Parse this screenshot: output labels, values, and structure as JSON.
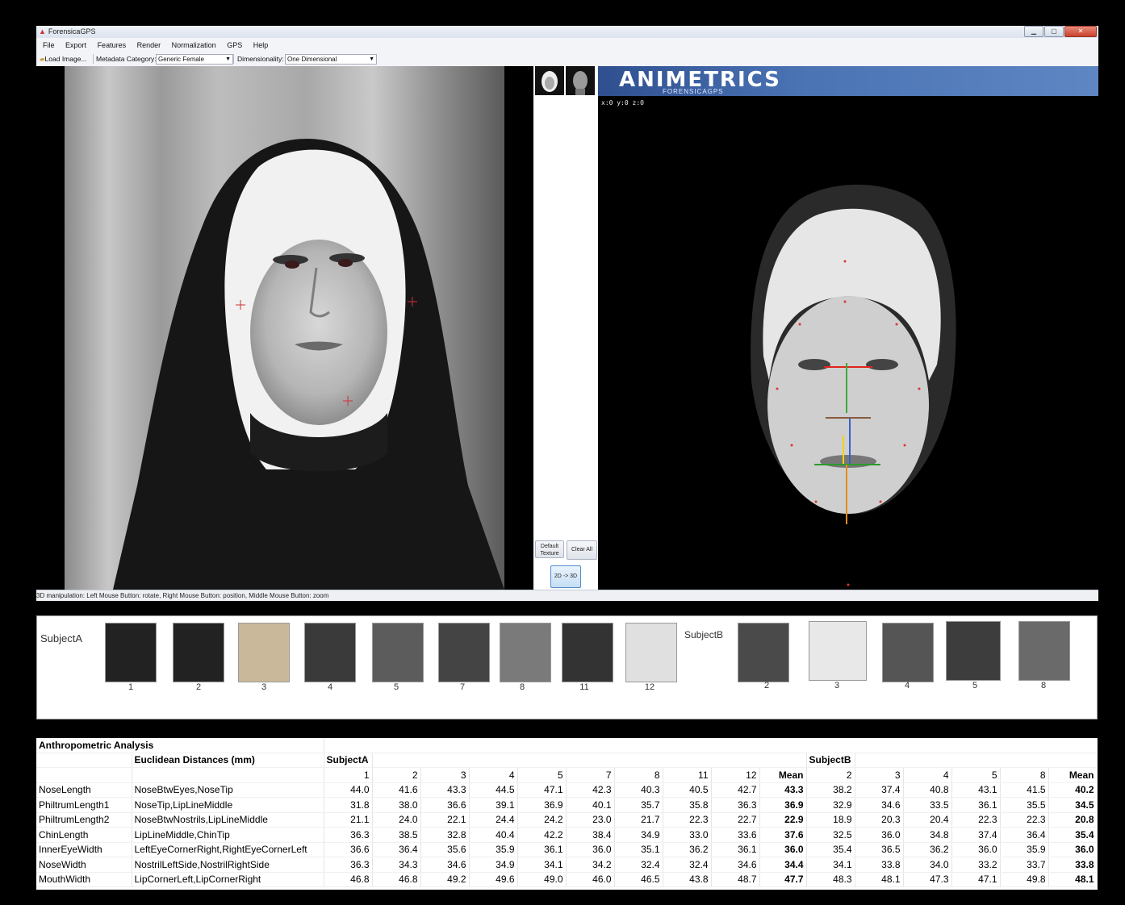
{
  "window": {
    "title": "ForensicaGPS",
    "menu": [
      "File",
      "Export",
      "Features",
      "Render",
      "Normalization",
      "GPS",
      "Help"
    ],
    "toolbar": {
      "load_button": "Load Image...",
      "metadata_label": "Metadata Category:",
      "metadata_value": "Generic Female",
      "dimensionality_label": "Dimensionality:",
      "dimensionality_value": "One Dimensional"
    },
    "mid_buttons": {
      "default_texture": "Default Texture",
      "clear_all": "Clear All",
      "convert": "2D -> 3D"
    },
    "banner": {
      "logo": "ANIMETRICS",
      "sub": "FORENSICAGPS"
    },
    "coords": "x:0  y:0  z:0",
    "status": "3D manipulation:  Left Mouse Button: rotate,  Right Mouse Button: position,  Middle Mouse Button: zoom"
  },
  "gallery": {
    "subject_a_label": "SubjectA",
    "subject_a_numbers": [
      "1",
      "2",
      "3",
      "4",
      "5",
      "7",
      "8",
      "11",
      "12"
    ],
    "subject_b_label": "SubjectB",
    "subject_b_numbers": [
      "2",
      "3",
      "4",
      "5",
      "8"
    ]
  },
  "table": {
    "title": "Anthropometric Analysis",
    "distances_header": "Euclidean Distances (mm)",
    "subject_a": "SubjectA",
    "subject_b": "SubjectB",
    "cols_a": [
      "1",
      "2",
      "3",
      "4",
      "5",
      "7",
      "8",
      "11",
      "12",
      "Mean"
    ],
    "cols_b": [
      "2",
      "3",
      "4",
      "5",
      "8",
      "Mean"
    ],
    "rows": [
      {
        "name": "NoseLength",
        "points": "NoseBtwEyes,NoseTip",
        "a": [
          "44.0",
          "41.6",
          "43.3",
          "44.5",
          "47.1",
          "42.3",
          "40.3",
          "40.5",
          "42.7",
          "43.3"
        ],
        "b": [
          "38.2",
          "37.4",
          "40.8",
          "43.1",
          "41.5",
          "40.2"
        ]
      },
      {
        "name": "PhiltrumLength1",
        "points": "NoseTip,LipLineMiddle",
        "a": [
          "31.8",
          "38.0",
          "36.6",
          "39.1",
          "36.9",
          "40.1",
          "35.7",
          "35.8",
          "36.3",
          "36.9"
        ],
        "b": [
          "32.9",
          "34.6",
          "33.5",
          "36.1",
          "35.5",
          "34.5"
        ]
      },
      {
        "name": "PhiltrumLength2",
        "points": "NoseBtwNostrils,LipLineMiddle",
        "a": [
          "21.1",
          "24.0",
          "22.1",
          "24.4",
          "24.2",
          "23.0",
          "21.7",
          "22.3",
          "22.7",
          "22.9"
        ],
        "b": [
          "18.9",
          "20.3",
          "20.4",
          "22.3",
          "22.3",
          "20.8"
        ]
      },
      {
        "name": "ChinLength",
        "points": "LipLineMiddle,ChinTip",
        "a": [
          "36.3",
          "38.5",
          "32.8",
          "40.4",
          "42.2",
          "38.4",
          "34.9",
          "33.0",
          "33.6",
          "37.6"
        ],
        "b": [
          "32.5",
          "36.0",
          "34.8",
          "37.4",
          "36.4",
          "35.4"
        ]
      },
      {
        "name": "InnerEyeWidth",
        "points": "LeftEyeCornerRight,RightEyeCornerLeft",
        "a": [
          "36.6",
          "36.4",
          "35.6",
          "35.9",
          "36.1",
          "36.0",
          "35.1",
          "36.2",
          "36.1",
          "36.0"
        ],
        "b": [
          "35.4",
          "36.5",
          "36.2",
          "36.0",
          "35.9",
          "36.0"
        ]
      },
      {
        "name": "NoseWidth",
        "points": "NostrilLeftSide,NostrilRightSide",
        "a": [
          "36.3",
          "34.3",
          "34.6",
          "34.9",
          "34.1",
          "34.2",
          "32.4",
          "32.4",
          "34.6",
          "34.4"
        ],
        "b": [
          "34.1",
          "33.8",
          "34.0",
          "33.2",
          "33.7",
          "33.8"
        ]
      },
      {
        "name": "MouthWidth",
        "points": "LipCornerLeft,LipCornerRight",
        "a": [
          "46.8",
          "46.8",
          "49.2",
          "49.6",
          "49.0",
          "46.0",
          "46.5",
          "43.8",
          "48.7",
          "47.7"
        ],
        "b": [
          "48.3",
          "48.1",
          "47.3",
          "47.1",
          "49.8",
          "48.1"
        ]
      }
    ]
  }
}
